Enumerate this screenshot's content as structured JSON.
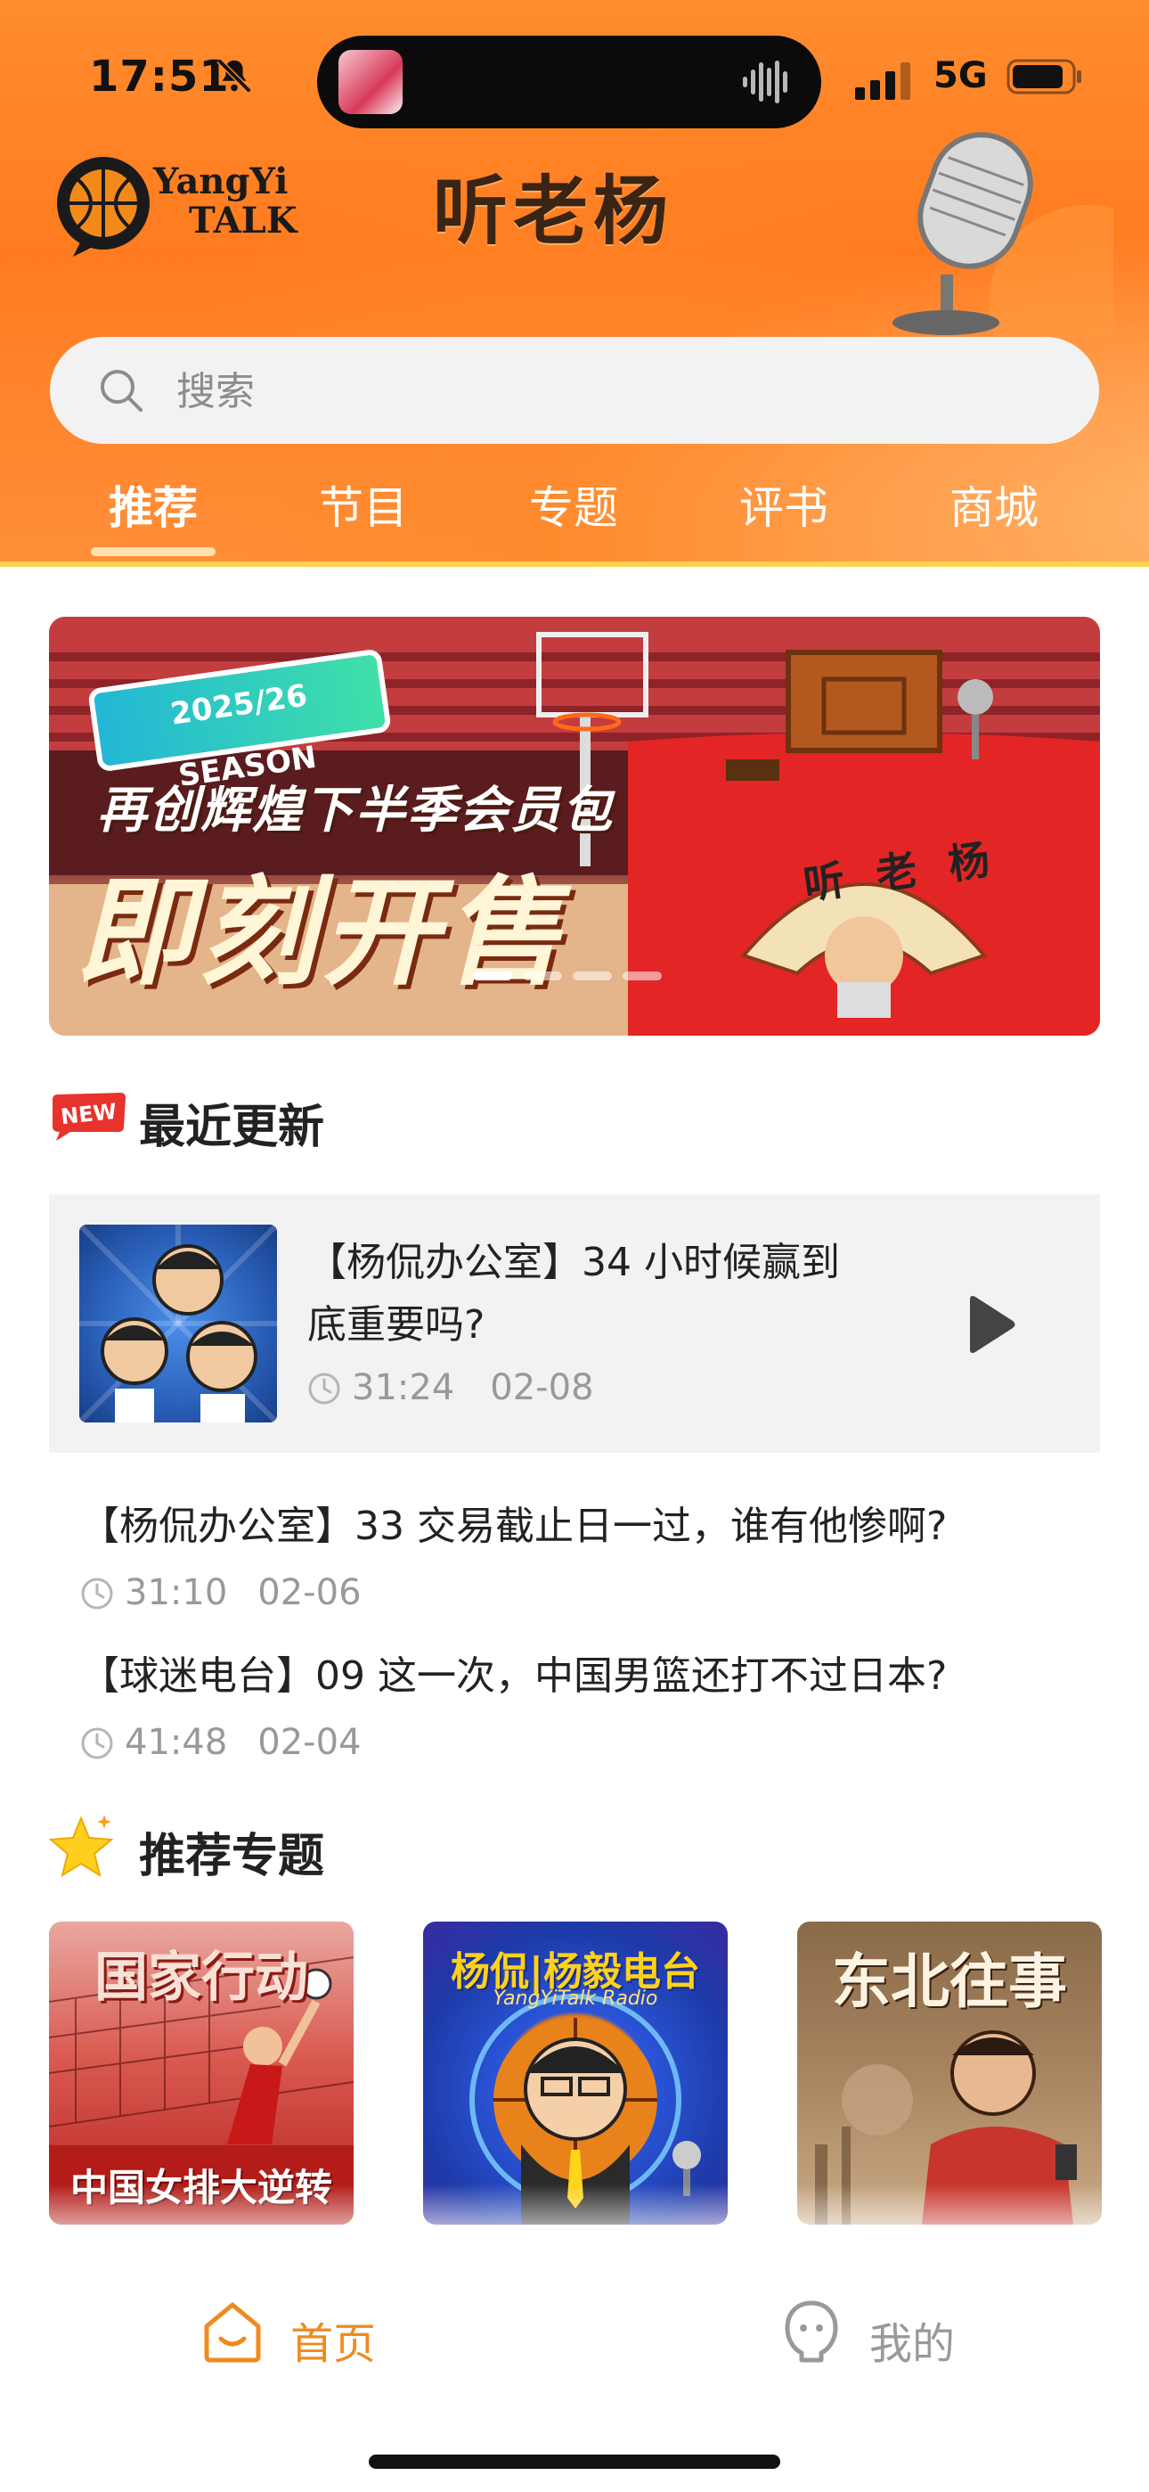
{
  "status_bar": {
    "time": "17:51",
    "network": "5G"
  },
  "header": {
    "logo_text_line1": "YangYi",
    "logo_text_line2": "TALK",
    "title": "听老杨",
    "search_placeholder": "搜索",
    "tabs": [
      {
        "label": "推荐",
        "active": true
      },
      {
        "label": "节目",
        "active": false
      },
      {
        "label": "专题",
        "active": false
      },
      {
        "label": "评书",
        "active": false
      },
      {
        "label": "商城",
        "active": false
      }
    ]
  },
  "banner": {
    "season_badge": "2025/26 SEASON",
    "subtitle": "再创辉煌下半季会员包",
    "headline": "即刻开售",
    "fan_text": "听老杨",
    "slide_count": 4,
    "active_slide": 0
  },
  "recent": {
    "badge": "NEW",
    "title": "最近更新",
    "featured": {
      "title": "【杨侃办公室】34 小时候赢到底重要吗?",
      "title_line1": "【杨侃办公室】34 小时候赢到",
      "title_line2": "底重要吗?",
      "duration": "31:24",
      "date": "02-08"
    },
    "episodes": [
      {
        "title": "【杨侃办公室】33 交易截止日一过，谁有他惨啊?",
        "duration": "31:10",
        "date": "02-06"
      },
      {
        "title": "【球迷电台】09 这一次，中国男篮还打不过日本?",
        "duration": "41:48",
        "date": "02-04"
      }
    ]
  },
  "topics": {
    "title": "推荐专题",
    "cards": [
      {
        "headline": "国家行动",
        "caption": "中国女排大逆转"
      },
      {
        "headline": "杨侃|杨毅电台",
        "caption": "YangYiTalk Radio"
      },
      {
        "headline": "东北往事",
        "caption": ""
      }
    ]
  },
  "tab_bar": {
    "items": [
      {
        "label": "首页",
        "active": true
      },
      {
        "label": "我的",
        "active": false
      }
    ]
  },
  "colors": {
    "accent": "#ff7b1f",
    "tab_active": "#f08a1e",
    "tab_inactive": "#999999"
  }
}
